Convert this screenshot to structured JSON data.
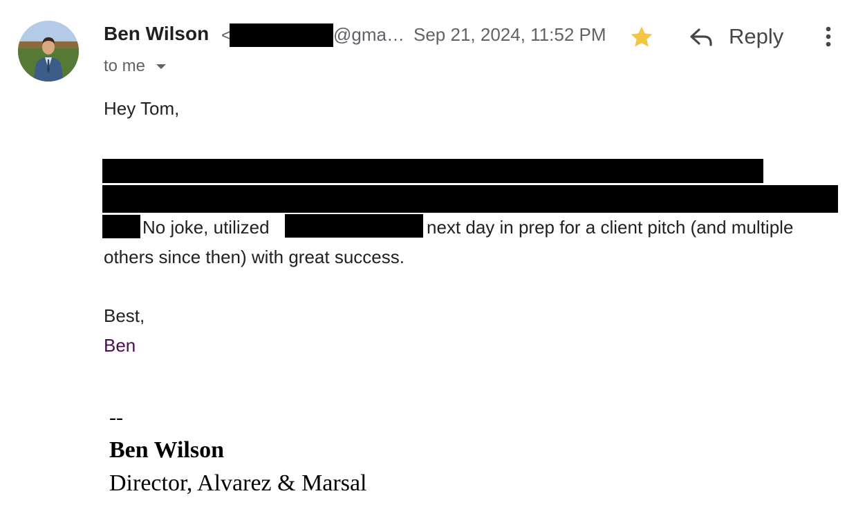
{
  "sender": {
    "name": "Ben Wilson",
    "angle_bracket": "<",
    "email_visible_part": "@gma…",
    "date": "Sep 21, 2024, 11:52 PM",
    "avatar_icon": "profile-photo-man-in-suit"
  },
  "actions": {
    "star_icon": "star-icon",
    "star_color": "#f4c542",
    "reply_label": "Reply",
    "more_icon": "more-vert-icon"
  },
  "recipient": {
    "label": "to me"
  },
  "message": {
    "greeting": "Hey Tom,",
    "line3_part1": "No joke, utilized",
    "line3_part2": "next day in prep for a client pitch (and multiple",
    "line4": "others since then) with great success.",
    "closing": "Best,",
    "signoff_name": "Ben"
  },
  "signature": {
    "separator": "--",
    "name": "Ben Wilson",
    "title": "Director, Alvarez & Marsal"
  }
}
